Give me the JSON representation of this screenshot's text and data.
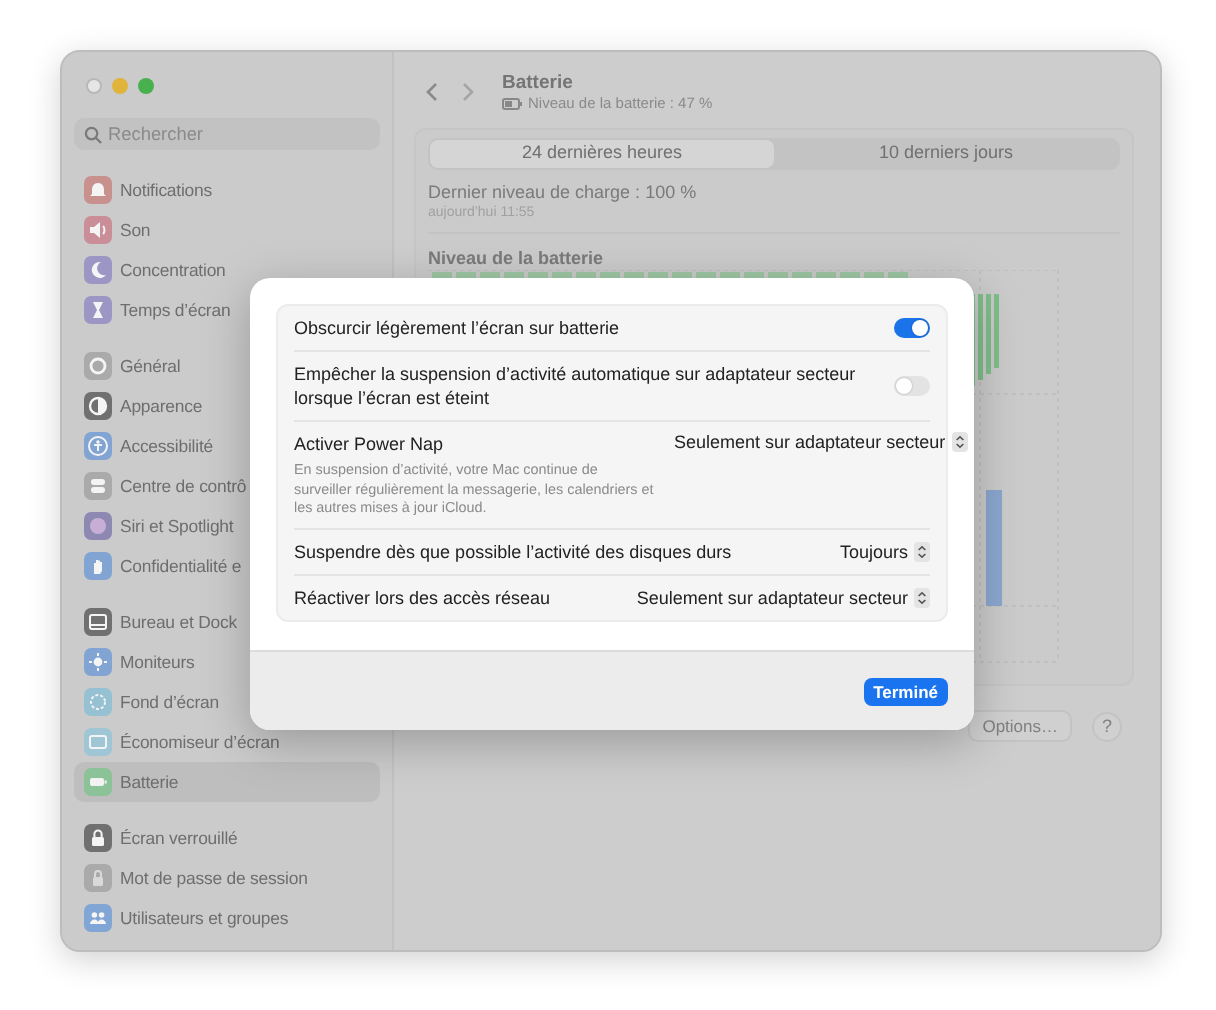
{
  "window": {
    "traffic_lights": true
  },
  "sidebar": {
    "search": {
      "placeholder": "Rechercher"
    },
    "groups": [
      {
        "items": [
          {
            "label": "Notifications",
            "selected": false
          },
          {
            "label": "Son",
            "selected": false
          },
          {
            "label": "Concentration",
            "selected": false
          },
          {
            "label": "Temps d’écran",
            "selected": false
          }
        ]
      },
      {
        "items": [
          {
            "label": "Général",
            "selected": false
          },
          {
            "label": "Apparence",
            "selected": false
          },
          {
            "label": "Accessibilité",
            "selected": false
          },
          {
            "label": "Centre de contrô",
            "selected": false
          },
          {
            "label": "Siri et Spotlight",
            "selected": false
          },
          {
            "label": "Confidentialité e",
            "selected": false
          }
        ]
      },
      {
        "items": [
          {
            "label": "Bureau et Dock",
            "selected": false
          },
          {
            "label": "Moniteurs",
            "selected": false
          },
          {
            "label": "Fond d’écran",
            "selected": false
          },
          {
            "label": "Économiseur d’écran",
            "selected": false
          },
          {
            "label": "Batterie",
            "selected": true
          }
        ]
      },
      {
        "items": [
          {
            "label": "Écran verrouillé",
            "selected": false
          },
          {
            "label": "Mot de passe de session",
            "selected": false
          },
          {
            "label": "Utilisateurs et groupes",
            "selected": false
          }
        ]
      }
    ]
  },
  "header": {
    "title": "Batterie",
    "subtitle": "Niveau de la batterie : 47 %"
  },
  "segments": [
    {
      "label": "24 dernières heures",
      "selected": true
    },
    {
      "label": "10 derniers jours",
      "selected": false
    }
  ],
  "last_charge": {
    "label": "Dernier niveau de charge : 100 %",
    "time": "aujourd’hui 11:55"
  },
  "chart_title": "Niveau de la batterie",
  "options_button": "Options…",
  "help_button": "?",
  "dialog": {
    "rows": [
      {
        "kind": "toggle",
        "label": "Obscurcir légèrement l’écran sur batterie",
        "on": true
      },
      {
        "kind": "toggle",
        "label": "Empêcher la suspension d’activité automatique sur adaptateur secteur lorsque l’écran est éteint",
        "on": false
      },
      {
        "kind": "select",
        "label": "Activer Power Nap",
        "description": "En suspension d’activité, votre Mac continue de surveiller régulièrement la messagerie, les calendriers et les autres mises à jour iCloud.",
        "value": "Seulement sur adaptateur secteur"
      },
      {
        "kind": "select",
        "label": "Suspendre dès que possible l’activité des disques durs",
        "value": "Toujours"
      },
      {
        "kind": "select",
        "label": "Réactiver lors des accès réseau",
        "value": "Seulement sur adaptateur secteur"
      }
    ],
    "done_button": "Terminé"
  }
}
